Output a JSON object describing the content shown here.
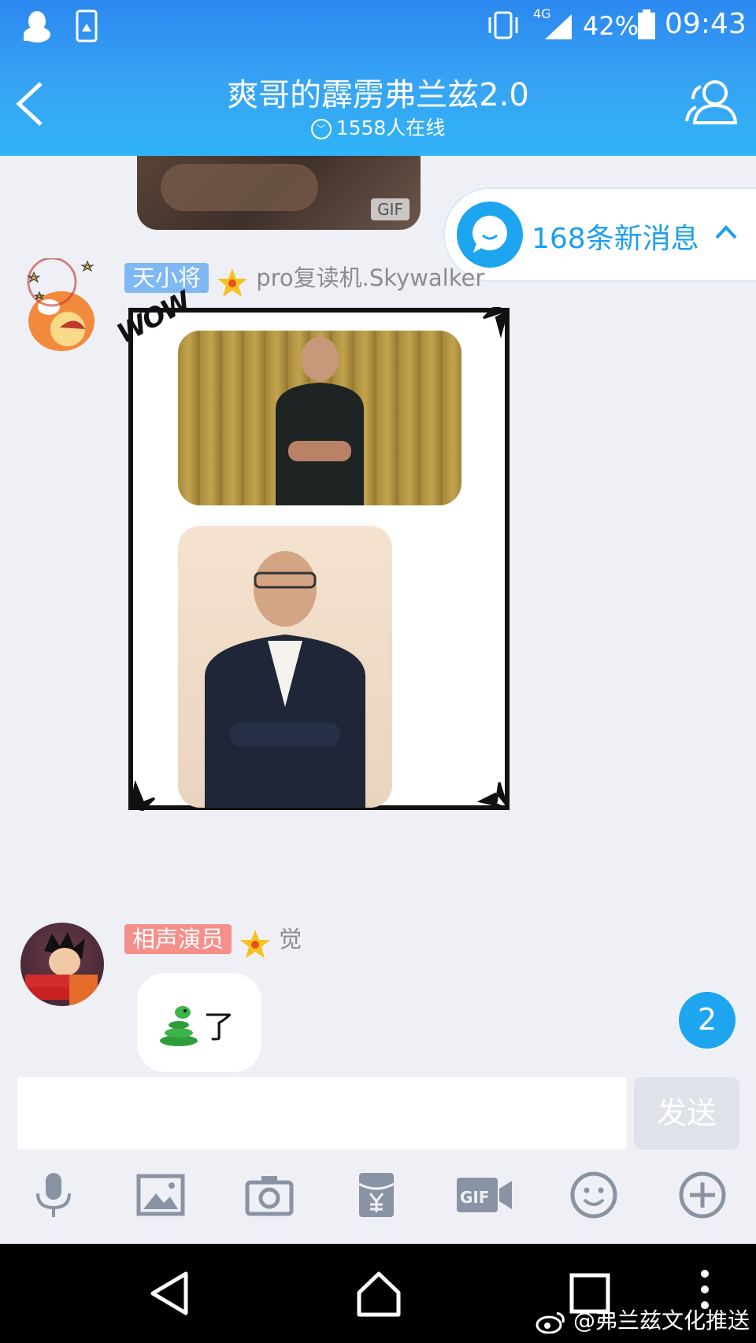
{
  "status": {
    "network": "4G",
    "battery": "42%",
    "time": "09:43"
  },
  "header": {
    "title": "爽哥的霹雳弗兰兹2.0",
    "online": "1558人在线"
  },
  "chat": {
    "new_messages": "168条新消息",
    "gif_badge": "GIF",
    "msg1": {
      "tag": "天小将",
      "tag_color": "#7fb8f4",
      "name": "pro复读机.Skywalker",
      "sticker_text": "WOW"
    },
    "msg2": {
      "tag": "相声演员",
      "tag_color": "#f58f8a",
      "name": "觉",
      "text": "了"
    },
    "unread_badge": "2"
  },
  "input": {
    "placeholder": "",
    "send_label": "发送"
  },
  "toolbar": {
    "icons": [
      "microphone-icon",
      "image-icon",
      "camera-icon",
      "red-packet-icon",
      "gif-video-icon",
      "emoji-icon",
      "plus-icon"
    ]
  },
  "watermark": "@弗兰兹文化推送"
}
